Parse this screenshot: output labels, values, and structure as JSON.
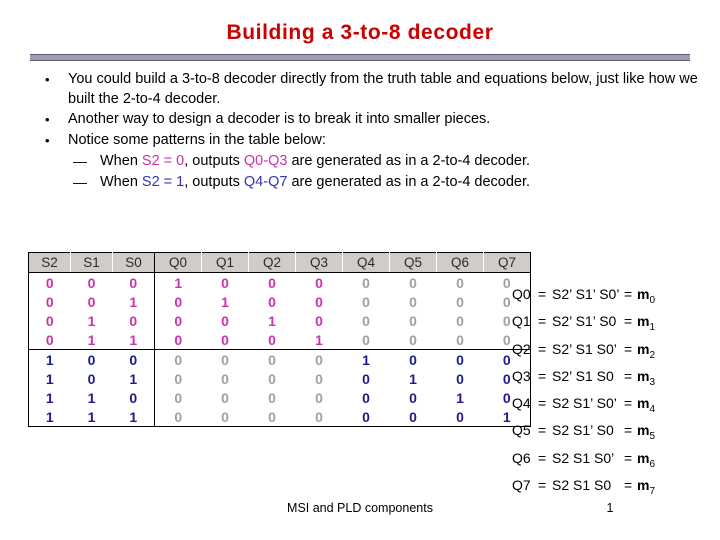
{
  "slide": {
    "title": "Building a 3-to-8 decoder",
    "accent_color": "#cc0000",
    "rule_color": "#9d9db4"
  },
  "bullets": [
    {
      "marker": "•",
      "text": "You could build a 3-to-8 decoder directly from the truth table and equations below, just like how we built the 2-to-4 decoder."
    },
    {
      "marker": "•",
      "text": "Another way to design a decoder is to break it into smaller pieces."
    },
    {
      "marker": "•",
      "text": "Notice some patterns in the table below:"
    }
  ],
  "sub_bullets": [
    {
      "marker": "—",
      "prefix": "When ",
      "cond": "S2 = 0",
      "cond_color": "#cc33aa",
      "mid": ", outputs ",
      "outputs": "Q0-Q3",
      "outputs_color": "#cc33aa",
      "suffix": " are generated as in a 2-to-4 decoder."
    },
    {
      "marker": "—",
      "prefix": "When ",
      "cond": "S2 = 1",
      "cond_color": "#3333bb",
      "mid": ", outputs ",
      "outputs": "Q4-Q7",
      "outputs_color": "#3333bb",
      "suffix": " are generated as in a 2-to-4 decoder."
    }
  ],
  "truth_table": {
    "headers": [
      "S2",
      "S1",
      "S0",
      "Q0",
      "Q1",
      "Q2",
      "Q3",
      "Q4",
      "Q5",
      "Q6",
      "Q7"
    ],
    "rows": [
      {
        "inputs": [
          "0",
          "0",
          "0"
        ],
        "outputs": [
          "1",
          "0",
          "0",
          "0",
          "0",
          "0",
          "0",
          "0"
        ]
      },
      {
        "inputs": [
          "0",
          "0",
          "1"
        ],
        "outputs": [
          "0",
          "1",
          "0",
          "0",
          "0",
          "0",
          "0",
          "0"
        ]
      },
      {
        "inputs": [
          "0",
          "1",
          "0"
        ],
        "outputs": [
          "0",
          "0",
          "1",
          "0",
          "0",
          "0",
          "0",
          "0"
        ]
      },
      {
        "inputs": [
          "0",
          "1",
          "1"
        ],
        "outputs": [
          "0",
          "0",
          "0",
          "1",
          "0",
          "0",
          "0",
          "0"
        ]
      },
      {
        "inputs": [
          "1",
          "0",
          "0"
        ],
        "outputs": [
          "0",
          "0",
          "0",
          "0",
          "1",
          "0",
          "0",
          "0"
        ]
      },
      {
        "inputs": [
          "1",
          "0",
          "1"
        ],
        "outputs": [
          "0",
          "0",
          "0",
          "0",
          "0",
          "1",
          "0",
          "0"
        ]
      },
      {
        "inputs": [
          "1",
          "1",
          "0"
        ],
        "outputs": [
          "0",
          "0",
          "0",
          "0",
          "0",
          "0",
          "1",
          "0"
        ]
      },
      {
        "inputs": [
          "1",
          "1",
          "1"
        ],
        "outputs": [
          "0",
          "0",
          "0",
          "0",
          "0",
          "0",
          "0",
          "1"
        ]
      }
    ],
    "colors": {
      "upper": "#cc33aa",
      "lower": "#1c1c8c",
      "inactive": "#a0a0a0",
      "header_bg": "#d0cdc8"
    }
  },
  "equations": [
    {
      "lhs": "Q0",
      "eq1": "=",
      "product": "S2’ S1’ S0’",
      "eq2": "=",
      "minterm": "m",
      "index": "0"
    },
    {
      "lhs": "Q1",
      "eq1": "=",
      "product": "S2’ S1’ S0",
      "eq2": "=",
      "minterm": "m",
      "index": "1"
    },
    {
      "lhs": "Q2",
      "eq1": "=",
      "product": "S2’ S1 S0’",
      "eq2": "=",
      "minterm": "m",
      "index": "2"
    },
    {
      "lhs": "Q3",
      "eq1": "=",
      "product": "S2’ S1 S0",
      "eq2": "=",
      "minterm": "m",
      "index": "3"
    },
    {
      "lhs": "Q4",
      "eq1": "=",
      "product": "S2 S1’ S0’",
      "eq2": "=",
      "minterm": "m",
      "index": "4"
    },
    {
      "lhs": "Q5",
      "eq1": "=",
      "product": "S2 S1’ S0",
      "eq2": "=",
      "minterm": "m",
      "index": "5"
    },
    {
      "lhs": "Q6",
      "eq1": "=",
      "product": "S2 S1 S0’",
      "eq2": "=",
      "minterm": "m",
      "index": "6"
    },
    {
      "lhs": "Q7",
      "eq1": "=",
      "product": "S2 S1 S0",
      "eq2": "=",
      "minterm": "m",
      "index": "7"
    }
  ],
  "footer": {
    "text": "MSI and PLD components",
    "page": "1"
  }
}
